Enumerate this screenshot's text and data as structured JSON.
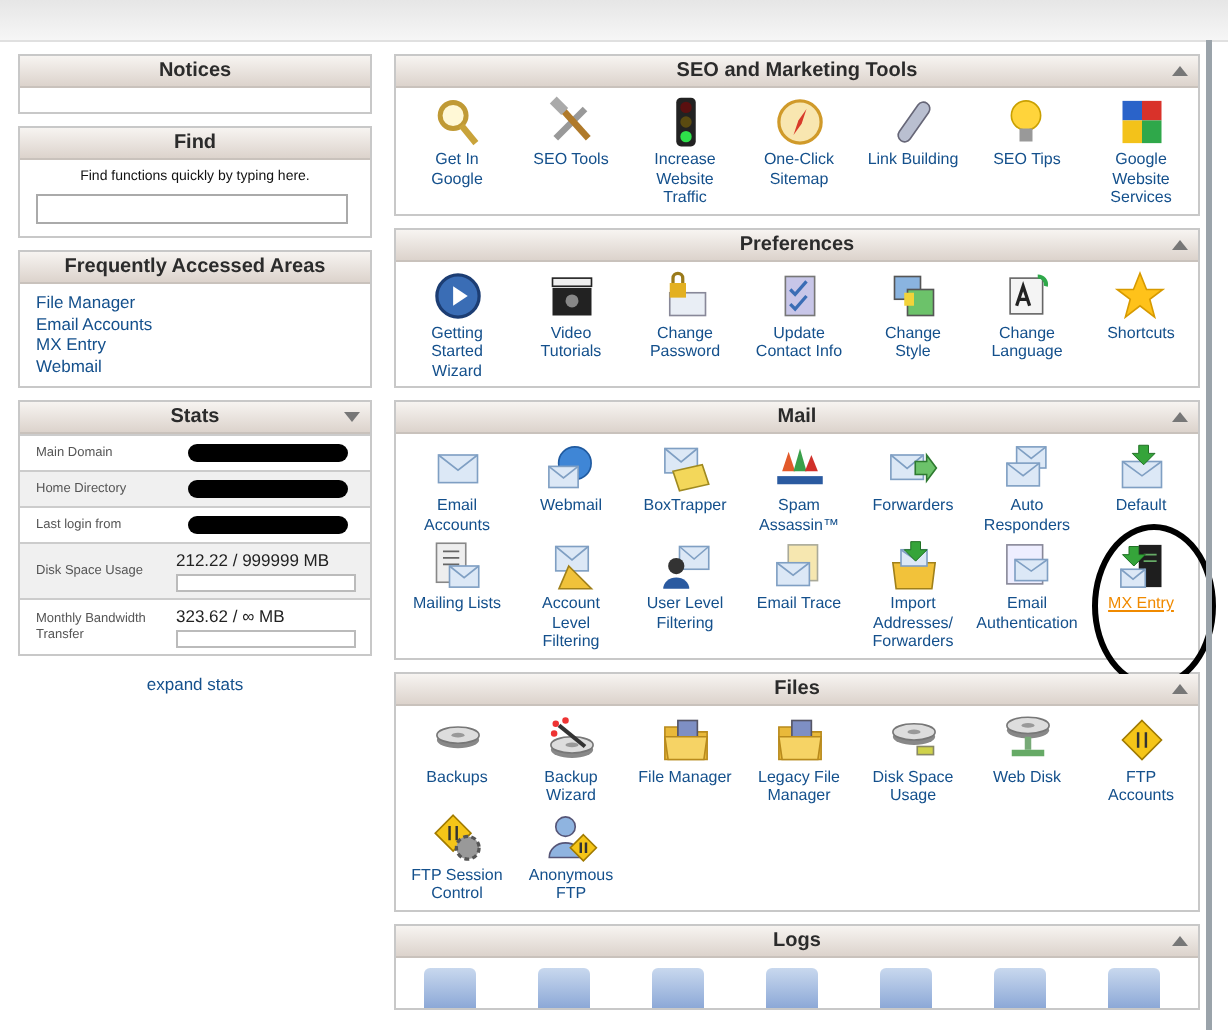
{
  "notices": {
    "title": "Notices"
  },
  "find": {
    "title": "Find",
    "hint": "Find functions quickly by typing here."
  },
  "frequently_accessed": {
    "title": "Frequently Accessed Areas",
    "links": [
      "File Manager",
      "Email Accounts",
      "MX Entry",
      "Webmail"
    ]
  },
  "stats": {
    "title": "Stats",
    "rows": [
      {
        "kind": "redacted",
        "label": "Main Domain"
      },
      {
        "kind": "redacted",
        "label": "Home Directory"
      },
      {
        "kind": "redacted",
        "label": "Last login from"
      },
      {
        "kind": "usage",
        "label": "Disk Space Usage",
        "value": "212.22 / 999999 MB"
      },
      {
        "kind": "usage",
        "label": "Monthly Bandwidth Transfer",
        "value": "323.62 / ∞ MB"
      }
    ],
    "expand_link": "expand stats"
  },
  "sections": [
    {
      "title": "SEO and Marketing Tools",
      "items": [
        {
          "label": "Get In Google",
          "highlighted": false,
          "circled": false
        },
        {
          "label": "SEO Tools",
          "highlighted": false,
          "circled": false
        },
        {
          "label": "Increase Website Traffic",
          "highlighted": false,
          "circled": false
        },
        {
          "label": "One-Click Sitemap",
          "highlighted": false,
          "circled": false
        },
        {
          "label": "Link Building",
          "highlighted": false,
          "circled": false
        },
        {
          "label": "SEO Tips",
          "highlighted": false,
          "circled": false
        },
        {
          "label": "Google Website Services",
          "highlighted": false,
          "circled": false
        }
      ]
    },
    {
      "title": "Preferences",
      "items": [
        {
          "label": "Getting Started Wizard",
          "highlighted": false,
          "circled": false
        },
        {
          "label": "Video Tutorials",
          "highlighted": false,
          "circled": false
        },
        {
          "label": "Change Password",
          "highlighted": false,
          "circled": false
        },
        {
          "label": "Update Contact Info",
          "highlighted": false,
          "circled": false
        },
        {
          "label": "Change Style",
          "highlighted": false,
          "circled": false
        },
        {
          "label": "Change Language",
          "highlighted": false,
          "circled": false
        },
        {
          "label": "Shortcuts",
          "highlighted": false,
          "circled": false
        }
      ]
    },
    {
      "title": "Mail",
      "items": [
        {
          "label": "Email Accounts",
          "highlighted": false,
          "circled": false
        },
        {
          "label": "Webmail",
          "highlighted": false,
          "circled": false
        },
        {
          "label": "BoxTrapper",
          "highlighted": false,
          "circled": false
        },
        {
          "label": "Spam Assassin™",
          "highlighted": false,
          "circled": false
        },
        {
          "label": "Forwarders",
          "highlighted": false,
          "circled": false
        },
        {
          "label": "Auto Responders",
          "highlighted": false,
          "circled": false
        },
        {
          "label": "Default",
          "highlighted": false,
          "circled": false
        },
        {
          "label": "Mailing Lists",
          "highlighted": false,
          "circled": false
        },
        {
          "label": "Account Level Filtering",
          "highlighted": false,
          "circled": false
        },
        {
          "label": "User Level Filtering",
          "highlighted": false,
          "circled": false
        },
        {
          "label": "Email Trace",
          "highlighted": false,
          "circled": false
        },
        {
          "label": "Import Addresses/ Forwarders",
          "highlighted": false,
          "circled": false
        },
        {
          "label": "Email Authentication",
          "highlighted": false,
          "circled": false
        },
        {
          "label": "MX Entry",
          "highlighted": true,
          "circled": true
        }
      ]
    },
    {
      "title": "Files",
      "items": [
        {
          "label": "Backups",
          "highlighted": false,
          "circled": false
        },
        {
          "label": "Backup Wizard",
          "highlighted": false,
          "circled": false
        },
        {
          "label": "File Manager",
          "highlighted": false,
          "circled": false
        },
        {
          "label": "Legacy File Manager",
          "highlighted": false,
          "circled": false
        },
        {
          "label": "Disk Space Usage",
          "highlighted": false,
          "circled": false
        },
        {
          "label": "Web Disk",
          "highlighted": false,
          "circled": false
        },
        {
          "label": "FTP Accounts",
          "highlighted": false,
          "circled": false
        },
        {
          "label": "FTP Session Control",
          "highlighted": false,
          "circled": false
        },
        {
          "label": "Anonymous FTP",
          "highlighted": false,
          "circled": false
        }
      ]
    },
    {
      "title": "Logs"
    }
  ]
}
